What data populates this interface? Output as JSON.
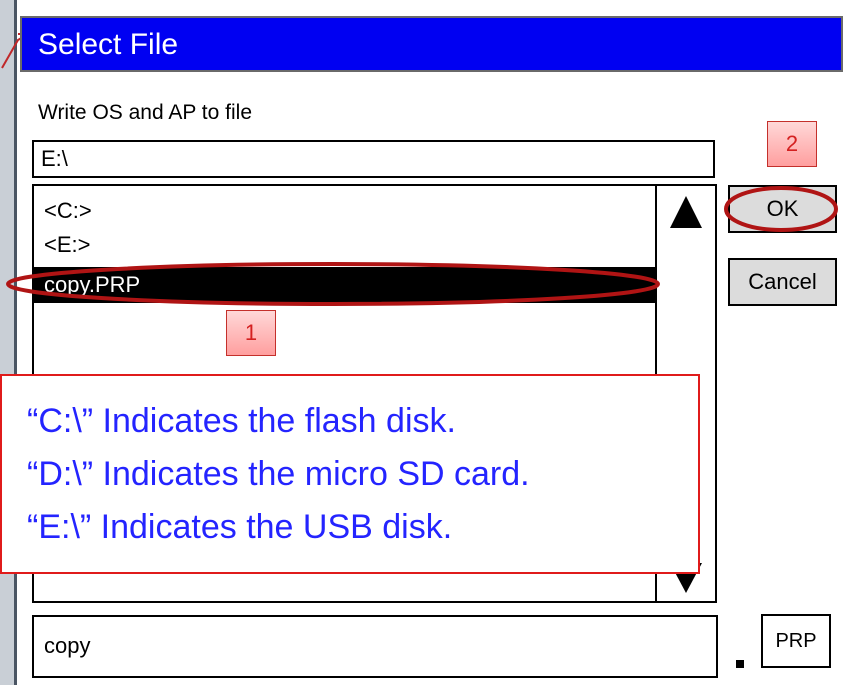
{
  "dialog": {
    "title": "Select File",
    "prompt": "Write OS and AP to file",
    "current_path": "E:\\",
    "list_items": [
      "<C:>",
      "<E:>",
      "copy.PRP"
    ],
    "selected_index": 2,
    "ok_label": "OK",
    "cancel_label": "Cancel",
    "filename": "copy",
    "extension_separator": ".",
    "extension": "PRP"
  },
  "annotations": {
    "step1": "1",
    "step2": "2",
    "note_lines": [
      "“C:\\” Indicates the flash disk.",
      "“D:\\” Indicates the micro SD card.",
      "“E:\\” Indicates the USB disk."
    ],
    "highlight_color": "#b01414",
    "callout_text_color": "#2424ff",
    "title_bar_color": "#0000f2"
  },
  "icons": {
    "scroll_up": "triangle-up-icon",
    "scroll_down": "triangle-down-icon",
    "pointer": "arrow-pointer-icon"
  }
}
